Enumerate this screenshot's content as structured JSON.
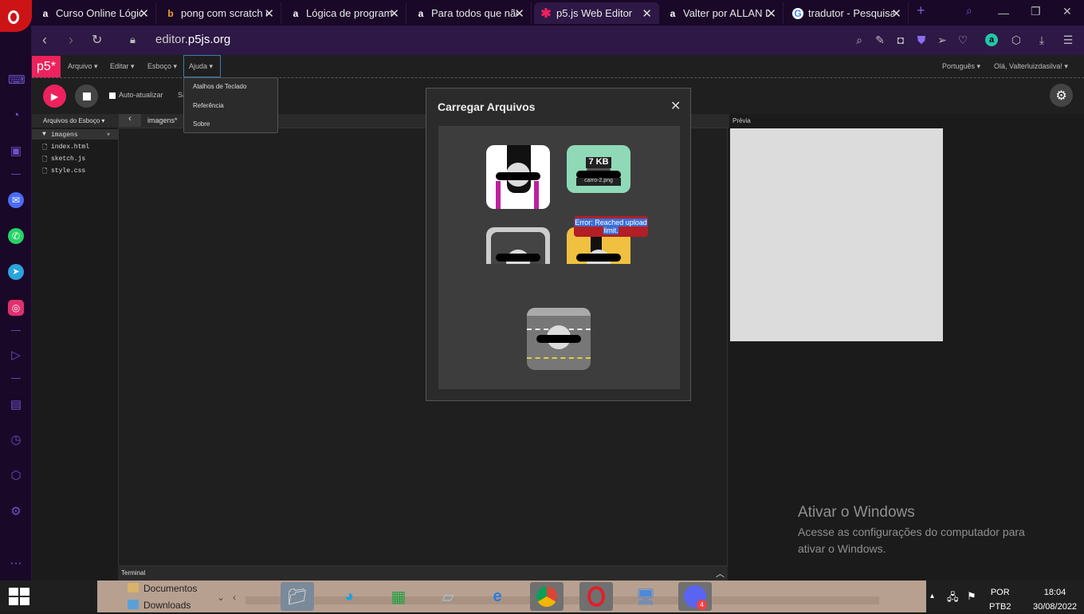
{
  "browser": {
    "tabs": [
      {
        "title": "Curso Online Lógic",
        "favicon": "a"
      },
      {
        "title": "pong com scratch c",
        "favicon": "b"
      },
      {
        "title": "Lógica de programa",
        "favicon": "a"
      },
      {
        "title": "Para todos que não",
        "favicon": "a"
      },
      {
        "title": "p5.js Web Editor",
        "favicon": "✱"
      },
      {
        "title": "Valter por ALLAN D",
        "favicon": "a"
      },
      {
        "title": "tradutor - Pesquisa",
        "favicon": "G"
      }
    ],
    "url_prefix": "editor.",
    "url_domain": "p5js.org"
  },
  "p5": {
    "logo": "p5*",
    "menu": {
      "arquivo": "Arquivo ▾",
      "editar": "Editar ▾",
      "esboco": "Esboço ▾",
      "ajuda": "Ajuda ▾"
    },
    "lang": "Português ▾",
    "user": "Olá, Valterluizdasilva! ▾",
    "auto_refresh": "Auto-atualizar",
    "sketch_name_partial": "Sa",
    "help_menu": [
      "Atalhos de Teclado",
      "Referência",
      "Sobre"
    ],
    "files_header": "Arquivos do Esboço ▾",
    "folder": "imagens",
    "files": [
      "index.html",
      "sketch.js",
      "style.css"
    ],
    "editor_tab": "imagens*",
    "preview_label": "Prévia",
    "terminal_label": "Terminal"
  },
  "modal": {
    "title": "Carregar Arquivos",
    "close": "✕",
    "thumb_size": "7 KB",
    "thumb_name": "carro-2.png",
    "error": "Error: Reached upload limit."
  },
  "watermark": {
    "line1": "Ativar o Windows",
    "line2": "Acesse as configurações do computador para ativar o Windows."
  },
  "taskbar": {
    "folder_items": [
      "Documentos",
      "Downloads"
    ],
    "lang": "POR",
    "layout": "PTB2",
    "time": "18:04",
    "date": "30/08/2022",
    "discord_badge": "4"
  }
}
